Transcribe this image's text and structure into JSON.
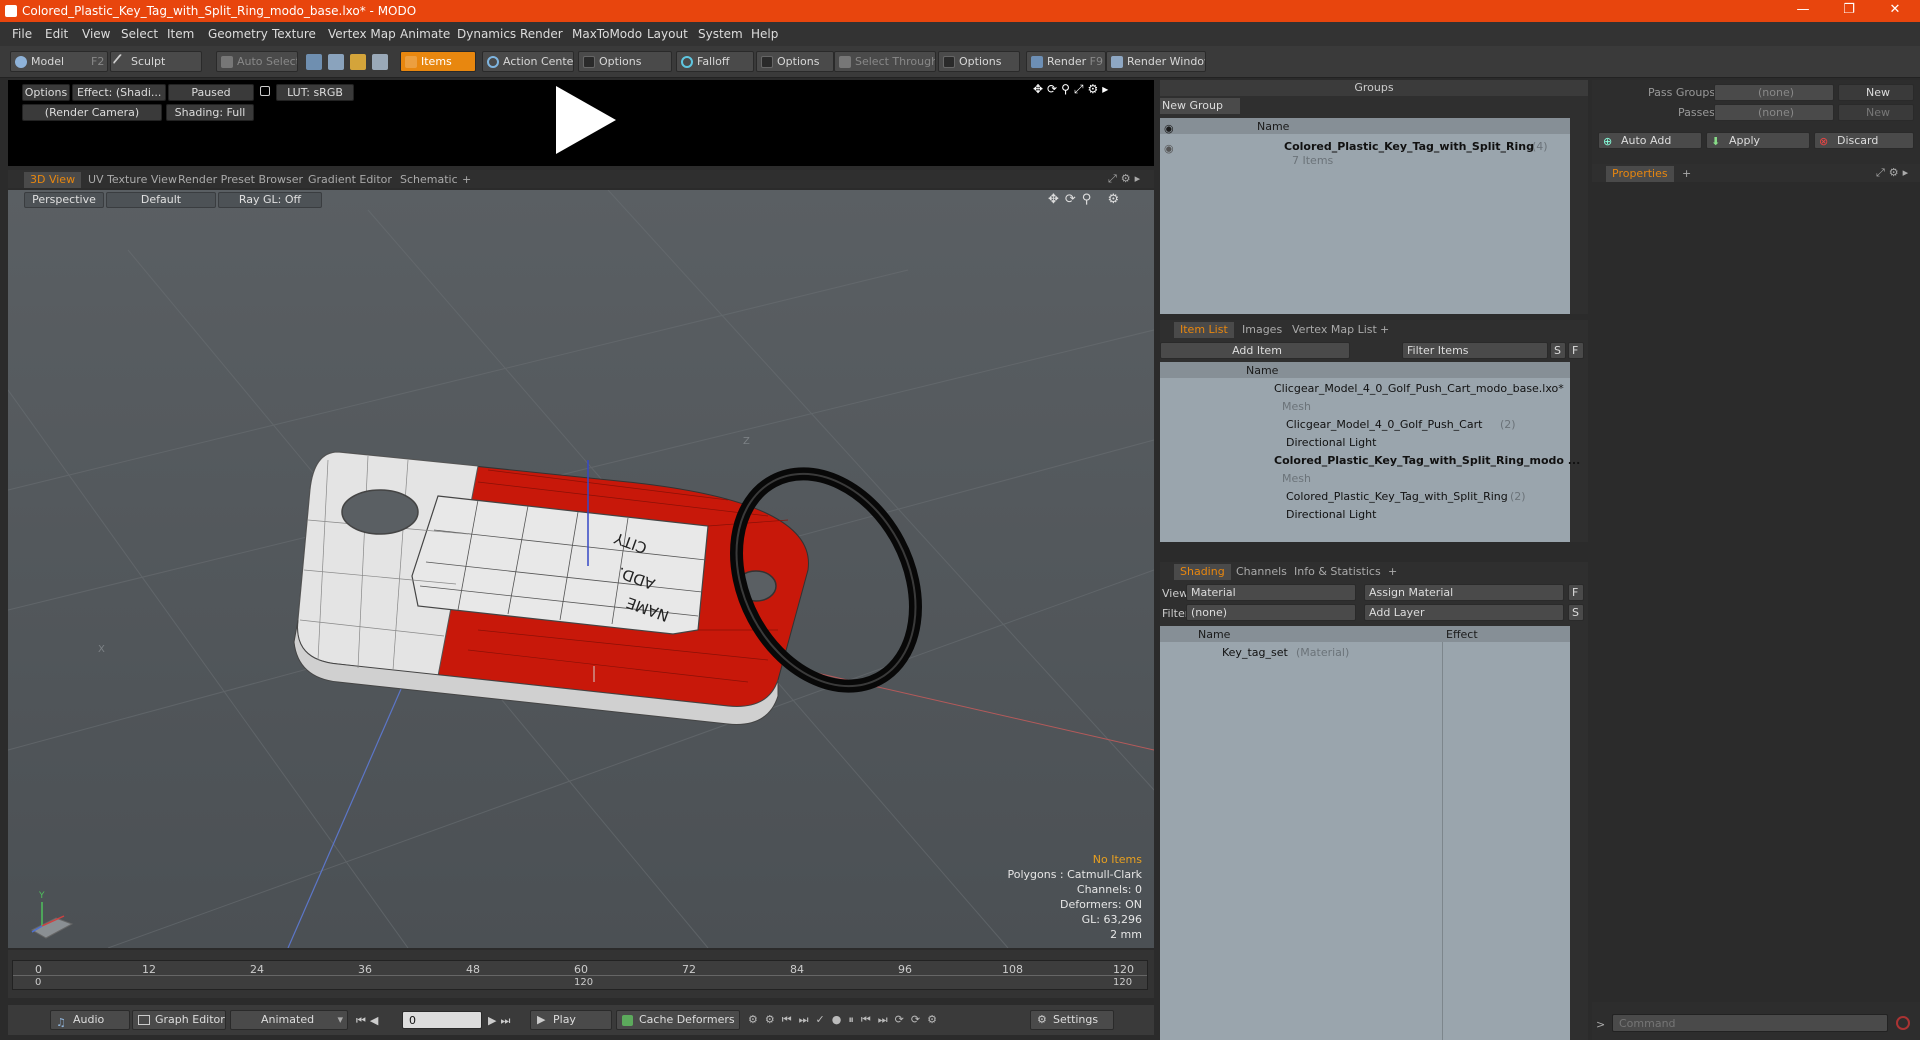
{
  "window": {
    "title": "Colored_Plastic_Key_Tag_with_Split_Ring_modo_base.lxo* - MODO",
    "minimize": "—",
    "maximize": "❐",
    "close": "✕"
  },
  "menu": [
    "File",
    "Edit",
    "View",
    "Select",
    "Item",
    "Geometry",
    "Texture",
    "Vertex Map",
    "Animate",
    "Dynamics",
    "Render",
    "MaxToModo",
    "Layout",
    "System",
    "Help"
  ],
  "toolbar": {
    "model": "Model",
    "model_key": "F2",
    "sculpt": "Sculpt",
    "auto_select": "Auto Select",
    "items": "Items",
    "action_center": "Action Center",
    "options1": "Options",
    "falloff": "Falloff",
    "options2": "Options",
    "select_through": "Select Through",
    "options3": "Options",
    "render": "Render",
    "render_key": "F9",
    "render_window": "Render Window"
  },
  "preview": {
    "options": "Options",
    "effect": "Effect: (Shadi...",
    "paused": "Paused",
    "lut": "LUT: sRGB",
    "camera": "(Render Camera)",
    "shading": "Shading: Full"
  },
  "view_tabs": [
    "3D View",
    "UV Texture View",
    "Render Preset Browser",
    "Gradient Editor",
    "Schematic",
    "+"
  ],
  "viewport": {
    "perspective": "Perspective",
    "default": "Default",
    "raygl": "Ray GL: Off",
    "axis_z": "Z",
    "axis_x": "X",
    "axis_y": "Y",
    "tag_text": [
      "NAME",
      "ADD.",
      "CITY"
    ],
    "stats": {
      "no_items": "No Items",
      "polygons": "Polygons : Catmull-Clark",
      "channels": "Channels: 0",
      "deformers": "Deformers: ON",
      "gl": "GL: 63,296",
      "scale": "2 mm"
    }
  },
  "timeline": {
    "ticks": [
      "0",
      "12",
      "24",
      "36",
      "48",
      "60",
      "72",
      "84",
      "96",
      "108",
      "120"
    ],
    "start": "0",
    "mid": "120",
    "end": "120"
  },
  "bottombar": {
    "audio": "Audio",
    "graph_editor": "Graph Editor",
    "animated": "Animated",
    "frame": "0",
    "play": "Play",
    "cache_deformers": "Cache Deformers",
    "settings": "Settings"
  },
  "groups": {
    "title": "Groups",
    "new_group": "New Group",
    "name_col": "Name",
    "item_name": "Colored_Plastic_Key_Tag_with_Split_Ring",
    "item_count": "(4)",
    "item_sub": "7 Items"
  },
  "item_list": {
    "tabs": [
      "Item List",
      "Images",
      "Vertex Map List",
      "+"
    ],
    "add_item": "Add Item",
    "filter_items": "Filter Items",
    "s": "S",
    "f": "F",
    "name_col": "Name",
    "rows": [
      {
        "label": "Clicgear_Model_4_0_Golf_Push_Cart_modo_base.lxo*",
        "style": ""
      },
      {
        "label": "Mesh",
        "style": "grey"
      },
      {
        "label": "Clicgear_Model_4_0_Golf_Push_Cart",
        "count": "(2)",
        "style": ""
      },
      {
        "label": "Directional Light",
        "style": ""
      },
      {
        "label": "Colored_Plastic_Key_Tag_with_Split_Ring_modo ...",
        "style": "bold"
      },
      {
        "label": "Mesh",
        "style": "grey"
      },
      {
        "label": "Colored_Plastic_Key_Tag_with_Split_Ring",
        "count": "(2)",
        "style": ""
      },
      {
        "label": "Directional Light",
        "style": ""
      }
    ]
  },
  "shading": {
    "tabs": [
      "Shading",
      "Channels",
      "Info & Statistics",
      "+"
    ],
    "view_label": "View",
    "view_value": "Material",
    "assign_material": "Assign Material",
    "f": "F",
    "filter_label": "Filter",
    "filter_value": "(none)",
    "add_layer": "Add Layer",
    "s": "S",
    "name_col": "Name",
    "effect_col": "Effect",
    "row_name": "Key_tag_set",
    "row_type": "(Material)"
  },
  "right_panel": {
    "pass_groups": "Pass Groups",
    "pass_groups_value": "(none)",
    "passes": "Passes",
    "passes_value": "(none)",
    "new1": "New",
    "new2": "New",
    "auto_add": "Auto Add",
    "apply": "Apply",
    "discard": "Discard",
    "properties": "Properties",
    "plus": "+",
    "command_placeholder": "Command"
  },
  "colors": {
    "accent": "#e8870f",
    "title_bar": "#e8450d",
    "tag_red": "#c8180a"
  }
}
